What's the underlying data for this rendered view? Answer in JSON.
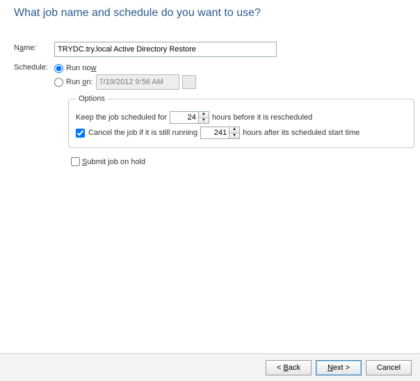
{
  "heading": "What job name and schedule do you want to use?",
  "nameLabelPre": "N",
  "nameLabelU": "a",
  "nameLabelPost": "me:",
  "nameValue": "TRYDC.try.local Active Directory Restore",
  "scheduleLabel": "Schedule:",
  "runNowPre": "Run no",
  "runNowU": "w",
  "runOnPre": "Run ",
  "runOnU": "o",
  "runOnPost": "n:",
  "runOnDate": "7/19/2012 9:56 AM",
  "options": {
    "legend": "Options",
    "keepPre": "Keep the job scheduled for",
    "keepValue": "24",
    "keepPost": "hours before it is rescheduled",
    "cancelU": "C",
    "cancelPre": "ancel the job if it is still running",
    "cancelValue": "241",
    "cancelPost": "hours after its scheduled start time"
  },
  "submitU": "S",
  "submitRest": "ubmit job on hold",
  "buttons": {
    "backPre": "< ",
    "backU": "B",
    "backPost": "ack",
    "nextU": "N",
    "nextPost": "ext >",
    "cancel": "Cancel"
  }
}
